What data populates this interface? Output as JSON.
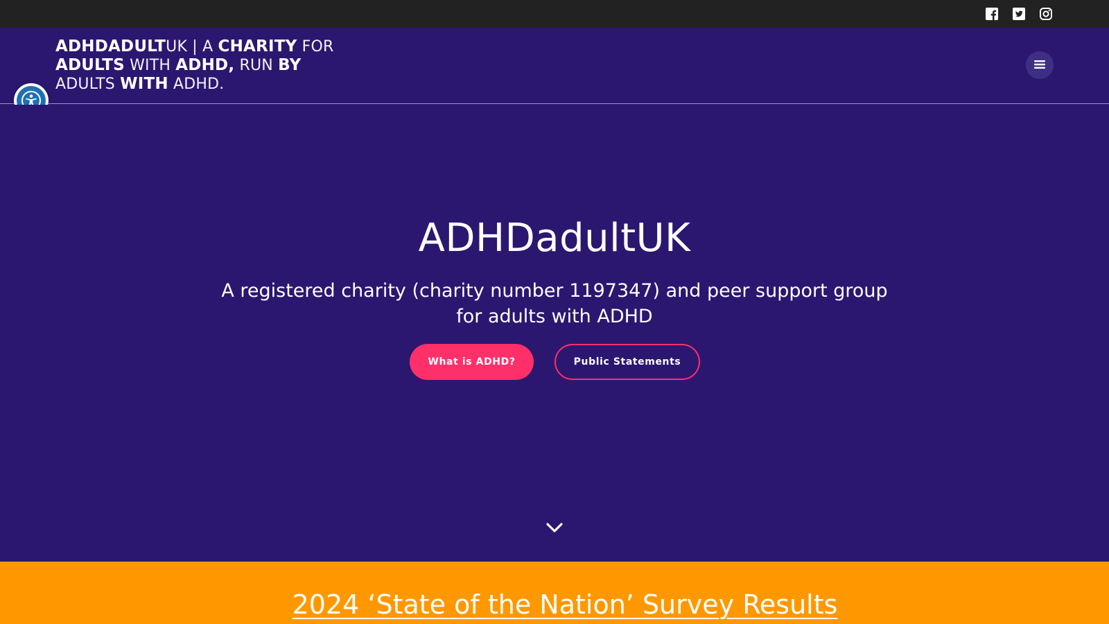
{
  "topbar": {
    "social": [
      {
        "name": "facebook-icon"
      },
      {
        "name": "twitter-icon"
      },
      {
        "name": "instagram-icon"
      }
    ]
  },
  "header": {
    "brand": {
      "line1_bold": "ADHDADULT",
      "line1_light": "UK | A ",
      "line1_bold2": "CHARITY",
      "line1_light2": " FOR",
      "line2_bold": "ADULTS",
      "line2_light": " WITH ",
      "line2_bold2": "ADHD,",
      "line2_light2": " RUN ",
      "line2_bold3": "BY",
      "line3_light": "ADULTS ",
      "line3_bold": "WITH",
      "line3_light2": " ADHD."
    },
    "menu_icon": "hamburger-icon"
  },
  "accessibility": {
    "icon": "accessibility-icon"
  },
  "hero": {
    "title": "ADHDadultUK",
    "subtitle": "A registered charity (charity number 1197347) and peer support group for adults with ADHD",
    "primary_button": "What is ADHD?",
    "secondary_button": "Public Statements",
    "scroll_icon": "chevron-down-icon"
  },
  "banner": {
    "link_text": "2024 ‘State of the Nation’ Survey Results"
  },
  "colors": {
    "topbar": "#222222",
    "brand_purple": "#2b1770",
    "accent_pink": "#ff2f6a",
    "banner_orange": "#ff9800",
    "accessibility_blue": "#1f6fb4"
  }
}
